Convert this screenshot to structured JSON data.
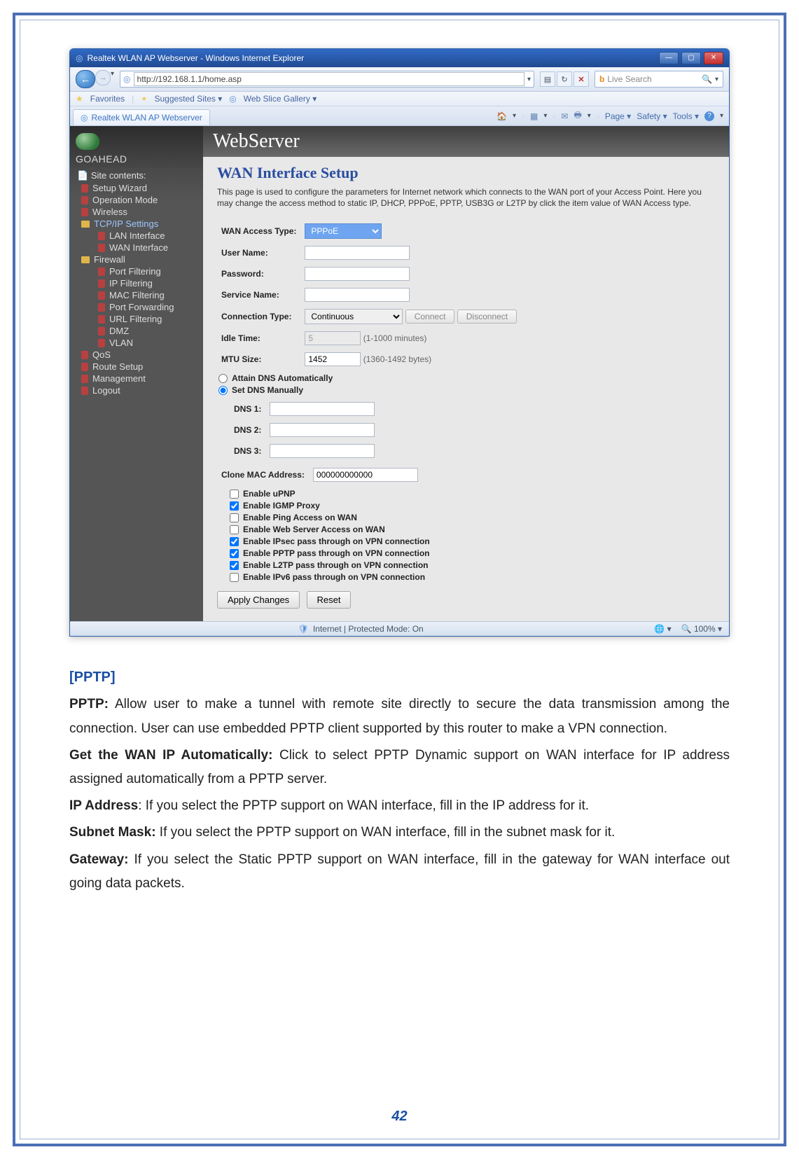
{
  "browser": {
    "title": "Realtek WLAN AP Webserver - Windows Internet Explorer",
    "url": "http://192.168.1.1/home.asp",
    "search_placeholder": "Live Search",
    "favorites_label": "Favorites",
    "suggested_sites": "Suggested Sites",
    "web_slice": "Web Slice Gallery",
    "tab_label": "Realtek WLAN AP Webserver",
    "cmd": {
      "page": "Page",
      "safety": "Safety",
      "tools": "Tools"
    },
    "status": {
      "mode": "Internet | Protected Mode: On",
      "zoom": "100%"
    },
    "bing_icon": "b"
  },
  "webserver": {
    "brand": "GOAHEAD",
    "header": "WebServer",
    "menu_title": "Site contents:",
    "menu": [
      {
        "label": "Setup Wizard"
      },
      {
        "label": "Operation Mode"
      },
      {
        "label": "Wireless"
      },
      {
        "label": "TCP/IP Settings",
        "folder": true,
        "active": true,
        "children": [
          {
            "label": "LAN Interface"
          },
          {
            "label": "WAN Interface"
          }
        ]
      },
      {
        "label": "Firewall",
        "folder": true,
        "children": [
          {
            "label": "Port Filtering"
          },
          {
            "label": "IP Filtering"
          },
          {
            "label": "MAC Filtering"
          },
          {
            "label": "Port Forwarding"
          },
          {
            "label": "URL Filtering"
          },
          {
            "label": "DMZ"
          },
          {
            "label": "VLAN"
          }
        ]
      },
      {
        "label": "QoS"
      },
      {
        "label": "Route Setup"
      },
      {
        "label": "Management"
      },
      {
        "label": "Logout"
      }
    ]
  },
  "form": {
    "title": "WAN Interface Setup",
    "desc": "This page is used to configure the parameters for Internet network which connects to the WAN port of your Access Point. Here you may change the access method to static IP, DHCP, PPPoE, PPTP, USB3G or L2TP by click the item value of WAN Access type.",
    "labels": {
      "wan_access": "WAN Access Type:",
      "user_name": "User Name:",
      "password": "Password:",
      "service_name": "Service Name:",
      "conn_type": "Connection Type:",
      "idle_time": "Idle Time:",
      "mtu_size": "MTU Size:",
      "dns1": "DNS 1:",
      "dns2": "DNS 2:",
      "dns3": "DNS 3:",
      "clone_mac": "Clone MAC Address:"
    },
    "values": {
      "wan_access": "PPPoE",
      "conn_type": "Continuous",
      "idle_time": "5",
      "idle_note": "(1-1000 minutes)",
      "mtu_size": "1452",
      "mtu_note": "(1360-1492 bytes)",
      "clone_mac": "000000000000",
      "user_name": "",
      "password": "",
      "service_name": "",
      "dns1": "",
      "dns2": "",
      "dns3": ""
    },
    "buttons": {
      "connect": "Connect",
      "disconnect": "Disconnect",
      "apply": "Apply Changes",
      "reset": "Reset"
    },
    "radios": {
      "auto_dns": "Attain DNS Automatically",
      "manual_dns": "Set DNS Manually"
    },
    "checks": [
      {
        "key": "upnp",
        "label": "Enable uPNP",
        "checked": false
      },
      {
        "key": "igmp",
        "label": "Enable IGMP Proxy",
        "checked": true
      },
      {
        "key": "ping",
        "label": "Enable Ping Access on WAN",
        "checked": false
      },
      {
        "key": "websrv",
        "label": "Enable Web Server Access on WAN",
        "checked": false
      },
      {
        "key": "ipsec",
        "label": "Enable IPsec pass through on VPN connection",
        "checked": true
      },
      {
        "key": "pptp",
        "label": "Enable PPTP pass through on VPN connection",
        "checked": true
      },
      {
        "key": "l2tp",
        "label": "Enable L2TP pass through on VPN connection",
        "checked": true
      },
      {
        "key": "ipv6",
        "label": "Enable IPv6 pass through on VPN connection",
        "checked": false
      }
    ]
  },
  "doc": {
    "section": "[PPTP]",
    "p1a": "PPTP:",
    "p1b": " Allow user to make a tunnel with remote site directly to secure the data transmission among the connection. User can use embedded PPTP client supported by this router to make a VPN connection.",
    "p2a": "Get the WAN IP Automatically:",
    "p2b": " Click to select PPTP Dynamic support on WAN interface for IP address assigned automatically from a PPTP server.",
    "p3a": "IP Address",
    "p3b": ": If you select the PPTP support on WAN interface, fill in the IP address for it.",
    "p4a": "Subnet Mask:",
    "p4b": " If you select the PPTP support on WAN interface, fill in the subnet mask for it.",
    "p5a": "Gateway:",
    "p5b": " If you select the Static PPTP support on WAN interface, fill in the gateway for WAN interface out going data packets.",
    "page_number": "42"
  }
}
